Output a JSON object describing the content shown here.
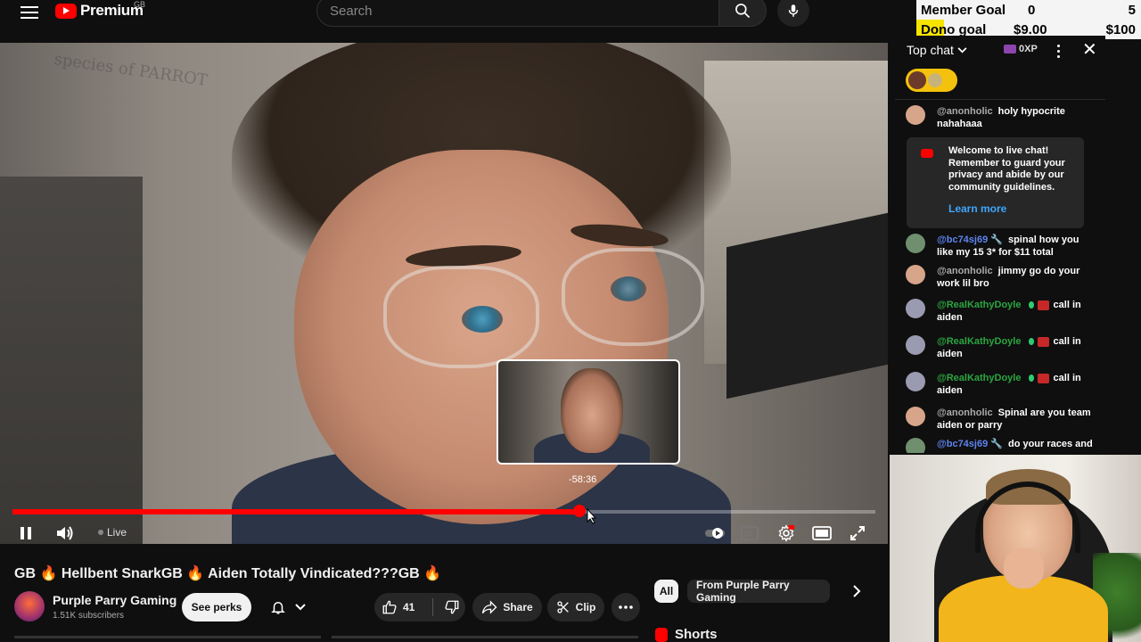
{
  "header": {
    "logo_text": "Premium",
    "region": "GB",
    "search_placeholder": "Search"
  },
  "goal_overlay": {
    "member": {
      "label": "Member Goal",
      "current": "0",
      "target": "5"
    },
    "dono": {
      "label": "Dono goal",
      "current": "$9.00",
      "target": "$100",
      "progress": 0.09
    }
  },
  "player": {
    "wall_text": "species of PARROT",
    "hover_time": "-58:36",
    "progress": 0.657,
    "live_label": "Live"
  },
  "video": {
    "title": "GB 🔥 Hellbent SnarkGB 🔥 Aiden Totally Vindicated???GB 🔥",
    "channel": "Purple Parry Gaming",
    "subscribers": "1.51K subscribers",
    "perks_label": "See perks",
    "like_count": "41",
    "share_label": "Share",
    "clip_label": "Clip"
  },
  "related": {
    "chips": [
      "All",
      "From Purple Parry Gaming"
    ],
    "shorts_label": "Shorts"
  },
  "chat": {
    "mode": "Top chat",
    "xp": "0XP",
    "messages": [
      {
        "author": "@anonholic",
        "text": "holy hypocrite nahahaaa"
      },
      {
        "author": "@bc74sj69 🔧",
        "text": "spinal how you like my 15 3* for $11 total"
      },
      {
        "author": "@anonholic",
        "text": "jimmy go do your work lil bro"
      },
      {
        "author": "@RealKathyDoyle",
        "text": "call in aiden"
      },
      {
        "author": "@RealKathyDoyle",
        "text": "call in aiden"
      },
      {
        "author": "@RealKathyDoyle",
        "text": "call in aiden"
      },
      {
        "author": "@anonholic",
        "text": "Spinal are you team aiden or parry"
      },
      {
        "author": "@bc74sj69 🔧",
        "text": "do your races and"
      }
    ],
    "welcome": {
      "text": "Welcome to live chat! Remember to guard your privacy and abide by our community guidelines.",
      "link": "Learn more"
    }
  },
  "colors": {
    "accent": "#ff0000",
    "link": "#3ea6ff",
    "goal_highlight": "#f5e400",
    "background": "#0f0f0f"
  }
}
